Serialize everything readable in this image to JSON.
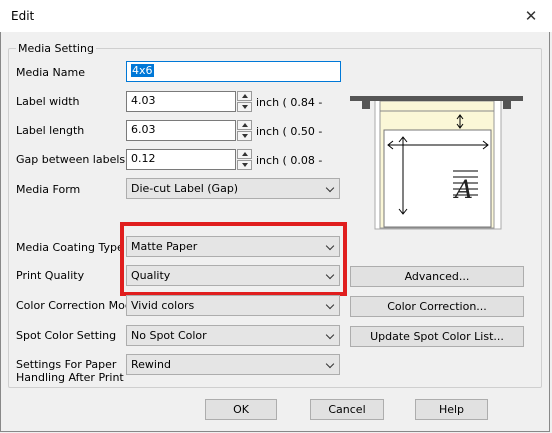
{
  "window": {
    "title": "Edit",
    "close_glyph": "✕"
  },
  "group": {
    "label": "Media Setting"
  },
  "media_name": {
    "label": "Media Name",
    "value": "4x6"
  },
  "label_width": {
    "label": "Label width",
    "value": "4.03",
    "unit": "inch ( 0.84 -"
  },
  "label_length": {
    "label": "Label length",
    "value": "6.03",
    "unit": "inch ( 0.50 -"
  },
  "gap": {
    "label": "Gap between labels",
    "value": "0.12",
    "unit": "inch ( 0.08 -"
  },
  "media_form": {
    "label": "Media Form",
    "value": "Die-cut Label (Gap)"
  },
  "media_coating": {
    "label": "Media Coating Type",
    "value": "Matte Paper"
  },
  "print_quality": {
    "label": "Print Quality",
    "value": "Quality"
  },
  "color_correction": {
    "label": "Color Correction Mode",
    "value": "Vivid colors"
  },
  "spot_color": {
    "label": "Spot Color Setting",
    "value": "No Spot Color"
  },
  "paper_handling": {
    "label_line1": "Settings For Paper",
    "label_line2": "Handling After Print",
    "value": "Rewind"
  },
  "buttons": {
    "advanced": "Advanced...",
    "color_correction": "Color Correction...",
    "update_spot": "Update Spot Color List...",
    "ok": "OK",
    "cancel": "Cancel",
    "help": "Help"
  },
  "preview": {
    "sample_letter": "A"
  },
  "colors": {
    "highlight": "#e01e1e",
    "selection": "#0078d7",
    "label_bg": "#fbf7d7"
  },
  "icons": [
    "close-icon",
    "spin-up-icon",
    "spin-down-icon",
    "chevron-down-icon"
  ]
}
